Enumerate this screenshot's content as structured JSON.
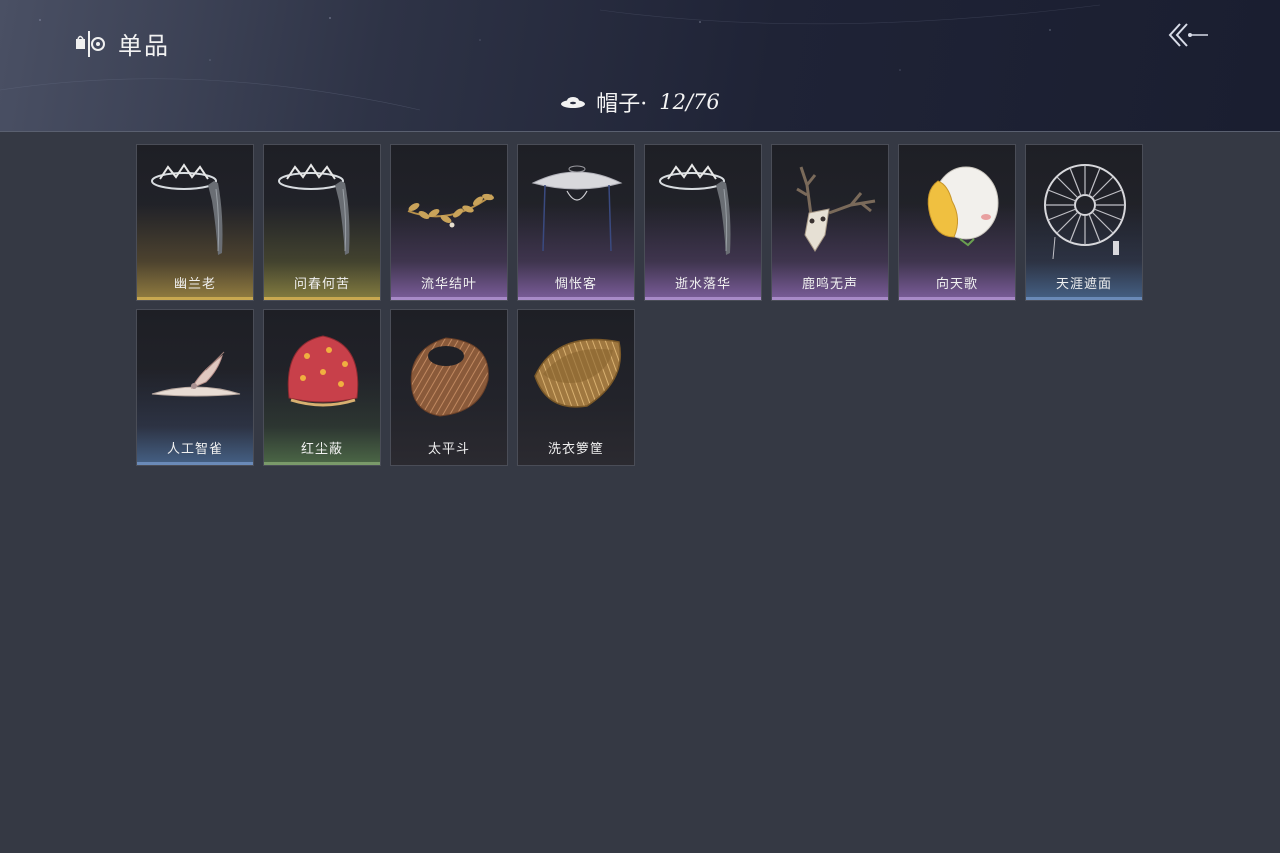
{
  "header": {
    "title": "单品",
    "title_icon": "wardrobe-icon",
    "back_icon": "back-arrow-icon"
  },
  "category": {
    "icon": "hat-icon",
    "label": "帽子·",
    "count": "12/76"
  },
  "items": [
    {
      "name": "幽兰老",
      "rarity_color": "#c8a850",
      "icon": "bone-crown-veil-hat"
    },
    {
      "name": "问春何苦",
      "rarity_color": "#c8a850",
      "icon": "bone-crown-veil-hat"
    },
    {
      "name": "流华结叶",
      "rarity_color": "#a88ac8",
      "icon": "golden-laurel-wreath"
    },
    {
      "name": "惆怅客",
      "rarity_color": "#a88ac8",
      "icon": "gauze-bamboo-hat"
    },
    {
      "name": "逝水落华",
      "rarity_color": "#a88ac8",
      "icon": "bone-crown-veil-hat"
    },
    {
      "name": "鹿鸣无声",
      "rarity_color": "#a88ac8",
      "icon": "deer-skull-antlers"
    },
    {
      "name": "向天歌",
      "rarity_color": "#a88ac8",
      "icon": "duck-head-hat"
    },
    {
      "name": "天涯遮面",
      "rarity_color": "#6a8ab8",
      "icon": "ring-veil-hat"
    },
    {
      "name": "人工智雀",
      "rarity_color": "#6a8ab8",
      "icon": "bird-ornament-hat"
    },
    {
      "name": "红尘蔽",
      "rarity_color": "#7a9a6a",
      "icon": "red-cloth-hood"
    },
    {
      "name": "太平斗",
      "rarity_color": "#c8c8c8",
      "icon": "woven-bucket-hat"
    },
    {
      "name": "洗衣箩筐",
      "rarity_color": "#c8c8c8",
      "icon": "laundry-basket-hat"
    }
  ]
}
